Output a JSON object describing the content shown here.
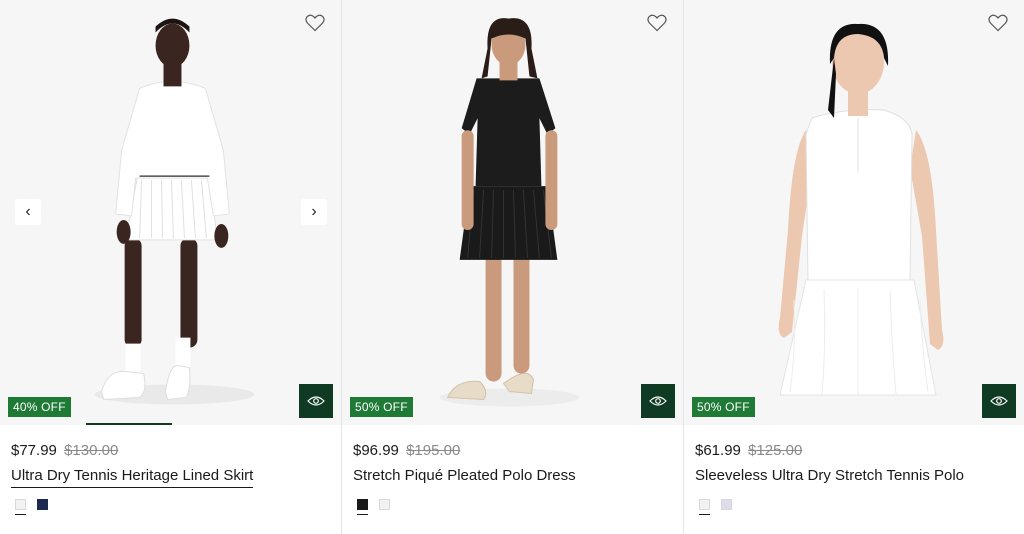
{
  "products": [
    {
      "price_now": "$77.99",
      "price_was": "$130.00",
      "discount_badge": "40% OFF",
      "name": "Ultra Dry Tennis Heritage Lined Skirt",
      "swatches": [
        "#f2f2f2",
        "#1c2a4f"
      ],
      "selected_swatch": 0,
      "has_carousel": true,
      "image_progress": 0.25,
      "image": "model in white sweater and white pleated tennis skirt"
    },
    {
      "price_now": "$96.99",
      "price_was": "$195.00",
      "discount_badge": "50% OFF",
      "name": "Stretch Piqué Pleated Polo Dress",
      "swatches": [
        "#1a1a1a",
        "#f2f2f2"
      ],
      "selected_swatch": 0,
      "has_carousel": false,
      "image": "model in black pleated polo dress"
    },
    {
      "price_now": "$61.99",
      "price_was": "$125.00",
      "discount_badge": "50% OFF",
      "name": "Sleeveless Ultra Dry Stretch Tennis Polo",
      "swatches": [
        "#f2f2f2",
        "#dcdcea"
      ],
      "selected_swatch": 0,
      "has_carousel": false,
      "image": "model in white sleeveless polo and white skirt"
    }
  ],
  "icons": {
    "wishlist": "heart-outline-icon",
    "quick_view": "eye-icon",
    "carousel_prev": "chevron-left-icon",
    "carousel_next": "chevron-right-icon"
  },
  "colors": {
    "badge": "#1f7a36",
    "quick_view": "#0f3b22",
    "image_bg": "#f6f6f6"
  }
}
